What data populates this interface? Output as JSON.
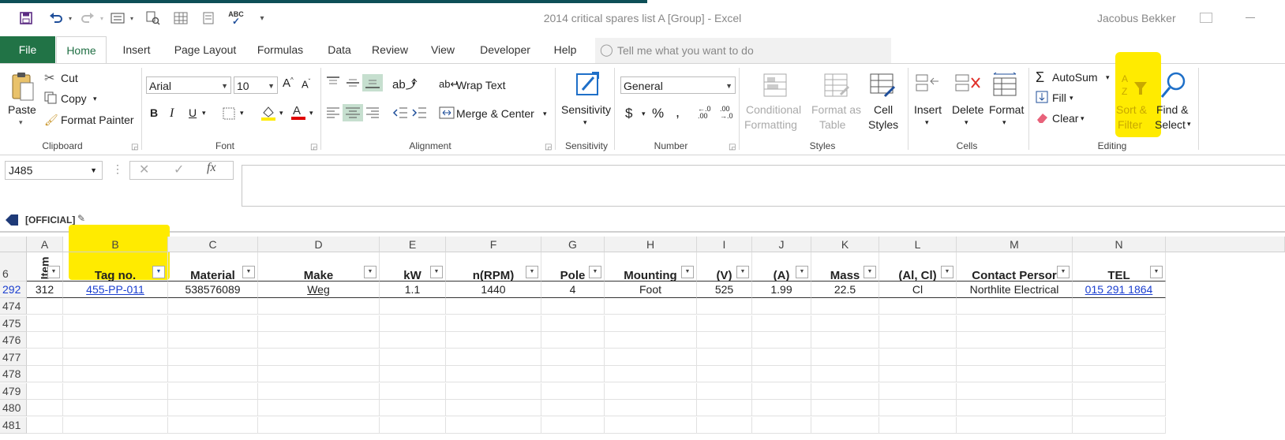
{
  "window": {
    "title": "2014 critical spares list A  [Group]  -  Excel",
    "user": "Jacobus Bekker"
  },
  "tabs": [
    "File",
    "Home",
    "Insert",
    "Page Layout",
    "Formulas",
    "Data",
    "Review",
    "View",
    "Developer",
    "Help"
  ],
  "tell_me": {
    "placeholder": "Tell me what you want to do"
  },
  "ribbon": {
    "clipboard": {
      "label": "Clipboard",
      "paste": "Paste",
      "cut": "Cut",
      "copy": "Copy",
      "format_painter": "Format Painter"
    },
    "font": {
      "label": "Font",
      "name": "Arial",
      "size": "10"
    },
    "alignment": {
      "label": "Alignment",
      "wrap_text": "Wrap Text",
      "merge_center": "Merge & Center"
    },
    "sensitivity": {
      "label": "Sensitivity",
      "button": "Sensitivity"
    },
    "number": {
      "label": "Number",
      "format": "General"
    },
    "styles": {
      "label": "Styles",
      "conditional_l1": "Conditional",
      "conditional_l2": "Formatting",
      "format_table_l1": "Format as",
      "format_table_l2": "Table",
      "cell_styles_l1": "Cell",
      "cell_styles_l2": "Styles"
    },
    "cells": {
      "label": "Cells",
      "insert": "Insert",
      "delete": "Delete",
      "format": "Format"
    },
    "editing": {
      "label": "Editing",
      "autosum": "AutoSum",
      "fill": "Fill",
      "clear": "Clear",
      "sort_l1": "Sort &",
      "sort_l2": "Filter",
      "find_l1": "Find &",
      "find_l2": "Select"
    }
  },
  "formula_bar": {
    "name_box": "J485",
    "value": ""
  },
  "label_bar": {
    "text": "[OFFICIAL]"
  },
  "columns": [
    "A",
    "B",
    "C",
    "D",
    "E",
    "F",
    "G",
    "H",
    "I",
    "J",
    "K",
    "L",
    "M",
    "N"
  ],
  "header_row": {
    "row": "6",
    "cells": [
      "Item",
      "Tag no.",
      "Material",
      "Make",
      "kW",
      "n(RPM)",
      "Pole",
      "Mounting",
      "(V)",
      "(A)",
      "Mass",
      "(Al, Cl)",
      "Contact Persor",
      "TEL"
    ]
  },
  "data_row": {
    "row": "292",
    "cells": [
      "312",
      "455-PP-011",
      "538576089",
      "Weg",
      "1.1",
      "1440",
      "4",
      "Foot",
      "525",
      "1.99",
      "22.5",
      "Cl",
      "Northlite Electrical",
      "015 291 1864"
    ]
  },
  "empty_rows": [
    "474",
    "475",
    "476",
    "477",
    "478",
    "479",
    "480",
    "481"
  ],
  "colors": {
    "accent": "#217346",
    "highlight": "#ffeb00",
    "link": "#1a3ecf"
  }
}
